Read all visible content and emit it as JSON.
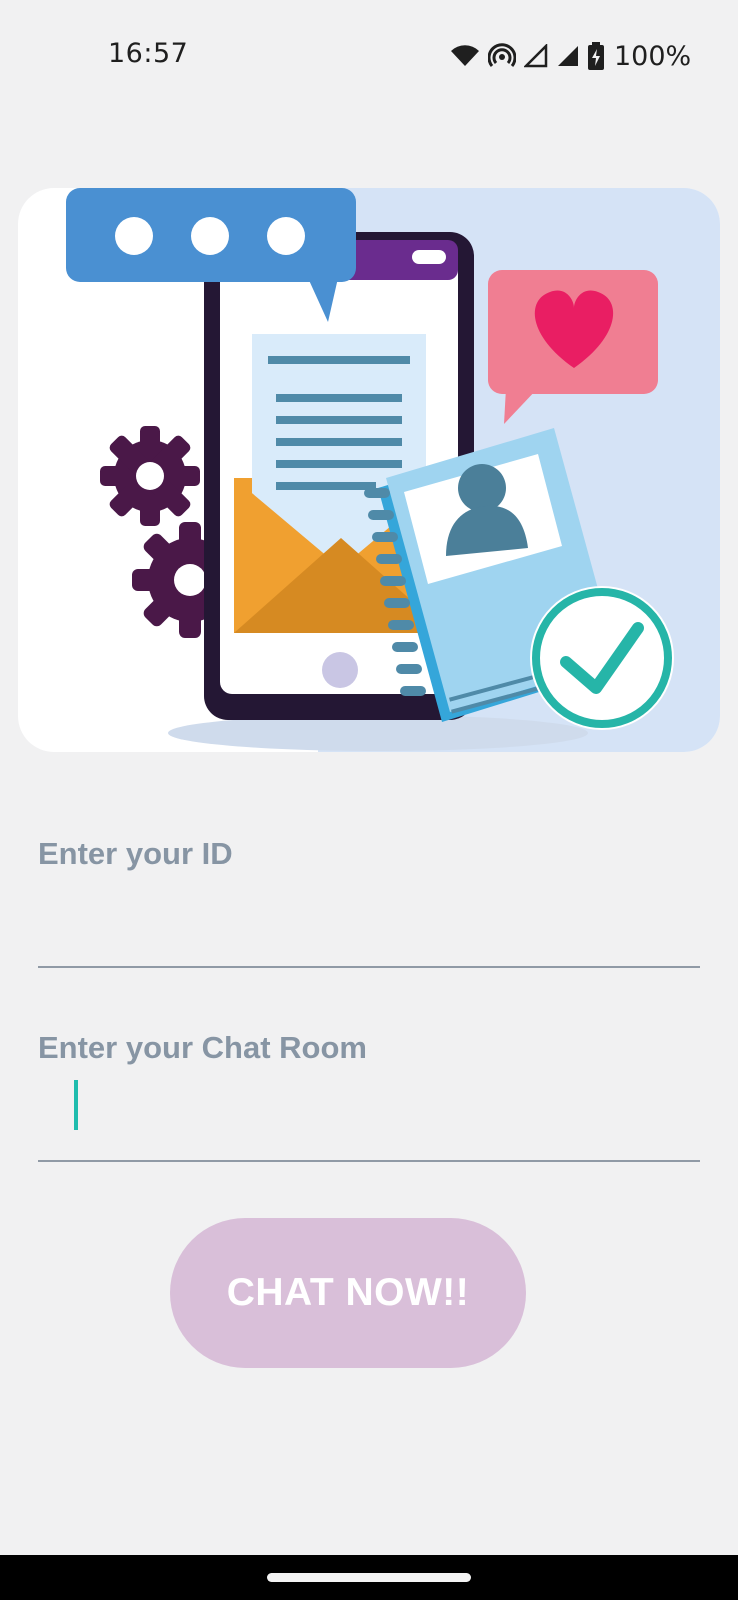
{
  "status_bar": {
    "time": "16:57",
    "battery": "100%",
    "icons": [
      "wifi-icon",
      "hotspot-icon",
      "signal-icon",
      "signal-icon",
      "battery-charging-icon"
    ]
  },
  "hero": {
    "illustration": "messaging-app-illustration",
    "colors": {
      "bubble_blue": "#4a90d2",
      "phone_purple": "#6a2c8e",
      "envelope_orange": "#f0a030",
      "heart_pink": "#e91e63",
      "check_teal": "#26b5a8"
    }
  },
  "form": {
    "id_label": "Enter your ID",
    "id_value": "",
    "room_label": "Enter your Chat Room",
    "room_value": ""
  },
  "button": {
    "label": "CHAT NOW!!",
    "color": "#d9bfd9"
  }
}
